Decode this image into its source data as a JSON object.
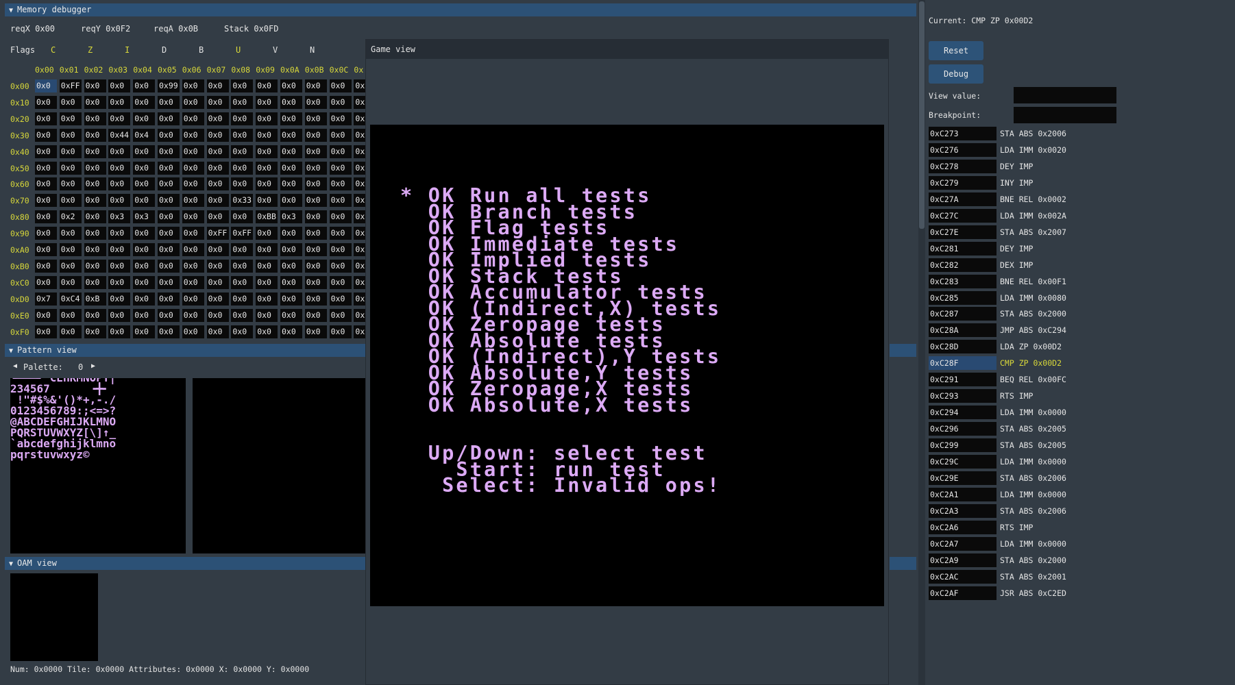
{
  "memory": {
    "title": "Memory debugger",
    "regs": [
      "reqX 0x00",
      "reqY 0x0F2",
      "reqA 0x0B",
      "Stack 0x0FD"
    ],
    "flags_label": "Flags",
    "flags": [
      {
        "name": "C",
        "on": true
      },
      {
        "name": "Z",
        "on": true
      },
      {
        "name": "I",
        "on": true
      },
      {
        "name": "D",
        "on": false
      },
      {
        "name": "B",
        "on": false
      },
      {
        "name": "U",
        "on": true
      },
      {
        "name": "V",
        "on": false
      },
      {
        "name": "N",
        "on": false
      }
    ],
    "col_headers": [
      "0x00",
      "0x01",
      "0x02",
      "0x03",
      "0x04",
      "0x05",
      "0x06",
      "0x07",
      "0x08",
      "0x09",
      "0x0A",
      "0x0B",
      "0x0C",
      "0x"
    ],
    "rows": [
      {
        "label": "0x00",
        "cells": [
          "0x0",
          "0xFF",
          "0x0",
          "0x0",
          "0x0",
          "0x99",
          "0x0",
          "0x0",
          "0x0",
          "0x0",
          "0x0",
          "0x0",
          "0x0",
          "0x"
        ]
      },
      {
        "label": "0x10",
        "cells": [
          "0x0",
          "0x0",
          "0x0",
          "0x0",
          "0x0",
          "0x0",
          "0x0",
          "0x0",
          "0x0",
          "0x0",
          "0x0",
          "0x0",
          "0x0",
          "0x"
        ]
      },
      {
        "label": "0x20",
        "cells": [
          "0x0",
          "0x0",
          "0x0",
          "0x0",
          "0x0",
          "0x0",
          "0x0",
          "0x0",
          "0x0",
          "0x0",
          "0x0",
          "0x0",
          "0x0",
          "0x"
        ]
      },
      {
        "label": "0x30",
        "cells": [
          "0x0",
          "0x0",
          "0x0",
          "0x44",
          "0x4",
          "0x0",
          "0x0",
          "0x0",
          "0x0",
          "0x0",
          "0x0",
          "0x0",
          "0x0",
          "0x"
        ]
      },
      {
        "label": "0x40",
        "cells": [
          "0x0",
          "0x0",
          "0x0",
          "0x0",
          "0x0",
          "0x0",
          "0x0",
          "0x0",
          "0x0",
          "0x0",
          "0x0",
          "0x0",
          "0x0",
          "0x"
        ]
      },
      {
        "label": "0x50",
        "cells": [
          "0x0",
          "0x0",
          "0x0",
          "0x0",
          "0x0",
          "0x0",
          "0x0",
          "0x0",
          "0x0",
          "0x0",
          "0x0",
          "0x0",
          "0x0",
          "0x"
        ]
      },
      {
        "label": "0x60",
        "cells": [
          "0x0",
          "0x0",
          "0x0",
          "0x0",
          "0x0",
          "0x0",
          "0x0",
          "0x0",
          "0x0",
          "0x0",
          "0x0",
          "0x0",
          "0x0",
          "0x"
        ]
      },
      {
        "label": "0x70",
        "cells": [
          "0x0",
          "0x0",
          "0x0",
          "0x0",
          "0x0",
          "0x0",
          "0x0",
          "0x0",
          "0x33",
          "0x0",
          "0x0",
          "0x0",
          "0x0",
          "0x"
        ]
      },
      {
        "label": "0x80",
        "cells": [
          "0x0",
          "0x2",
          "0x0",
          "0x3",
          "0x3",
          "0x0",
          "0x0",
          "0x0",
          "0x0",
          "0xBB",
          "0x3",
          "0x0",
          "0x0",
          "0x"
        ]
      },
      {
        "label": "0x90",
        "cells": [
          "0x0",
          "0x0",
          "0x0",
          "0x0",
          "0x0",
          "0x0",
          "0x0",
          "0xFF",
          "0xFF",
          "0x0",
          "0x0",
          "0x0",
          "0x0",
          "0x"
        ]
      },
      {
        "label": "0xA0",
        "cells": [
          "0x0",
          "0x0",
          "0x0",
          "0x0",
          "0x0",
          "0x0",
          "0x0",
          "0x0",
          "0x0",
          "0x0",
          "0x0",
          "0x0",
          "0x0",
          "0x"
        ]
      },
      {
        "label": "0xB0",
        "cells": [
          "0x0",
          "0x0",
          "0x0",
          "0x0",
          "0x0",
          "0x0",
          "0x0",
          "0x0",
          "0x0",
          "0x0",
          "0x0",
          "0x0",
          "0x0",
          "0x"
        ]
      },
      {
        "label": "0xC0",
        "cells": [
          "0x0",
          "0x0",
          "0x0",
          "0x0",
          "0x0",
          "0x0",
          "0x0",
          "0x0",
          "0x0",
          "0x0",
          "0x0",
          "0x0",
          "0x0",
          "0x"
        ]
      },
      {
        "label": "0xD0",
        "cells": [
          "0x7",
          "0xC4",
          "0xB",
          "0x0",
          "0x0",
          "0x0",
          "0x0",
          "0x0",
          "0x0",
          "0x0",
          "0x0",
          "0x0",
          "0x0",
          "0x"
        ]
      },
      {
        "label": "0xE0",
        "cells": [
          "0x0",
          "0x0",
          "0x0",
          "0x0",
          "0x0",
          "0x0",
          "0x0",
          "0x0",
          "0x0",
          "0x0",
          "0x0",
          "0x0",
          "0x0",
          "0x"
        ]
      },
      {
        "label": "0xF0",
        "cells": [
          "0x0",
          "0x0",
          "0x0",
          "0x0",
          "0x0",
          "0x0",
          "0x0",
          "0x0",
          "0x0",
          "0x0",
          "0x0",
          "0x0",
          "0x0",
          "0x"
        ]
      }
    ]
  },
  "pattern": {
    "title": "Pattern view",
    "palette_label": "Palette:",
    "palette_value": "0",
    "tiles": [
      "┗━━━┛ CEHKMNOPY|",
      "234567      ╺╋╸",
      " !\"#$%&'()*+,-./",
      "0123456789:;<=>?",
      "@ABCDEFGHIJKLMNO",
      "PQRSTUVWXYZ[\\]↑_",
      "`abcdefghijklmno",
      "pqrstuvwxyz©"
    ]
  },
  "oam": {
    "title": "OAM view",
    "status": "Num: 0x0000 Tile: 0x0000 Attributes: 0x0000 X: 0x0000 Y: 0x0000"
  },
  "game": {
    "title": "Game view",
    "lines": [
      "* OK Run all tests",
      "  OK Branch tests",
      "  OK Flag tests",
      "  OK Immediate tests",
      "  OK Implied tests",
      "  OK Stack tests",
      "  OK Accumulator tests",
      "  OK (Indirect,X) tests",
      "  OK Zeropage tests",
      "  OK Absolute tests",
      "  OK (Indirect),Y tests",
      "  OK Absolute,Y tests",
      "  OK Zeropage,X tests",
      "  OK Absolute,X tests",
      "",
      "",
      "  Up/Down: select test",
      "    Start: run test",
      "   Select: Invalid ops!"
    ],
    "text_color": "#dcaaf5"
  },
  "cpu": {
    "current": "Current: CMP ZP 0x00D2",
    "reset_label": "Reset",
    "debug_label": "Debug",
    "view_value_label": "View value:",
    "breakpoint_label": "Breakpoint:",
    "current_index": 14,
    "instructions": [
      {
        "addr": "0xC273",
        "op": "STA ABS 0x2006"
      },
      {
        "addr": "0xC276",
        "op": "LDA IMM 0x0020"
      },
      {
        "addr": "0xC278",
        "op": "DEY IMP"
      },
      {
        "addr": "0xC279",
        "op": "INY IMP"
      },
      {
        "addr": "0xC27A",
        "op": "BNE REL 0x0002"
      },
      {
        "addr": "0xC27C",
        "op": "LDA IMM 0x002A"
      },
      {
        "addr": "0xC27E",
        "op": "STA ABS 0x2007"
      },
      {
        "addr": "0xC281",
        "op": "DEY IMP"
      },
      {
        "addr": "0xC282",
        "op": "DEX IMP"
      },
      {
        "addr": "0xC283",
        "op": "BNE REL 0x00F1"
      },
      {
        "addr": "0xC285",
        "op": "LDA IMM 0x0080"
      },
      {
        "addr": "0xC287",
        "op": "STA ABS 0x2000"
      },
      {
        "addr": "0xC28A",
        "op": "JMP ABS 0xC294"
      },
      {
        "addr": "0xC28D",
        "op": "LDA ZP 0x00D2"
      },
      {
        "addr": "0xC28F",
        "op": "CMP ZP 0x00D2"
      },
      {
        "addr": "0xC291",
        "op": "BEQ REL 0x00FC"
      },
      {
        "addr": "0xC293",
        "op": "RTS IMP"
      },
      {
        "addr": "0xC294",
        "op": "LDA IMM 0x0000"
      },
      {
        "addr": "0xC296",
        "op": "STA ABS 0x2005"
      },
      {
        "addr": "0xC299",
        "op": "STA ABS 0x2005"
      },
      {
        "addr": "0xC29C",
        "op": "LDA IMM 0x0000"
      },
      {
        "addr": "0xC29E",
        "op": "STA ABS 0x2006"
      },
      {
        "addr": "0xC2A1",
        "op": "LDA IMM 0x0000"
      },
      {
        "addr": "0xC2A3",
        "op": "STA ABS 0x2006"
      },
      {
        "addr": "0xC2A6",
        "op": "RTS IMP"
      },
      {
        "addr": "0xC2A7",
        "op": "LDA IMM 0x0000"
      },
      {
        "addr": "0xC2A9",
        "op": "STA ABS 0x2000"
      },
      {
        "addr": "0xC2AC",
        "op": "STA ABS 0x2001"
      },
      {
        "addr": "0xC2AF",
        "op": "JSR ABS 0xC2ED"
      }
    ]
  }
}
